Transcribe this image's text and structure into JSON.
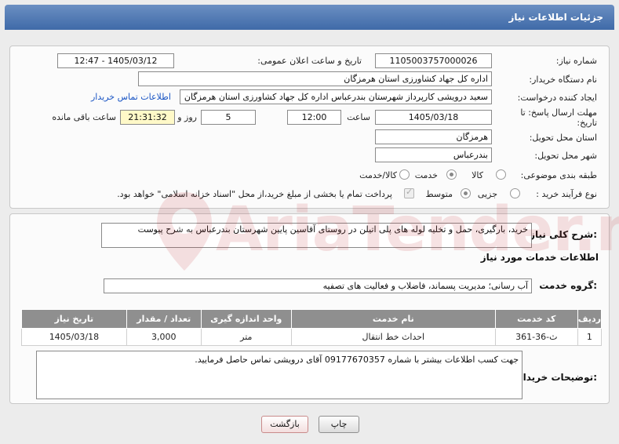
{
  "header": {
    "title": "جزئیات اطلاعات نیاز"
  },
  "form": {
    "need_number_label": "شماره نیاز:",
    "need_number": "1105003757000026",
    "announce_label": "تاریخ و ساعت اعلان عمومی:",
    "announce_value": "1405/03/12 - 12:47",
    "buyer_org_label": "نام دستگاه خریدار:",
    "buyer_org": "اداره کل جهاد کشاورزی استان هرمزگان",
    "creator_label": "ایجاد کننده درخواست:",
    "creator": "سعید درویشی کارپرداز شهرستان بندرعباس اداره کل جهاد کشاورزی استان هرمزگان",
    "contact_link": "اطلاعات تماس خریدار",
    "deadline_label": "مهلت ارسال پاسخ: تا تاریخ:",
    "deadline_date": "1405/03/18",
    "hour_label": "ساعت",
    "deadline_time": "12:00",
    "days_value": "5",
    "days_label": "روز و",
    "remaining_time": "21:31:32",
    "remaining_label": "ساعت باقی مانده",
    "province_label": "استان محل تحویل:",
    "province": "هرمزگان",
    "city_label": "شهر محل تحویل:",
    "city": "بندرعباس",
    "category_label": "طبقه بندی موضوعی:",
    "category_options": [
      "کالا",
      "خدمت",
      "کالا/خدمت"
    ],
    "process_label": "نوع فرآیند خرید :",
    "process_options": [
      "جزیی",
      "متوسط"
    ],
    "payment_note": "پرداخت تمام یا بخشی از مبلغ خرید،از محل \"اسناد خزانه اسلامی\" خواهد بود."
  },
  "summary": {
    "label": "شرح کلی نیاز:",
    "text": "خرید، بارگیری، حمل و تخلیه لوله های پلی اتیلن در روستای آقاسین پایین شهرستان بندرعباس به شرح پیوست"
  },
  "services": {
    "section_title": "اطلاعات خدمات مورد نیاز",
    "group_label": "گروه خدمت:",
    "group_value": "آب رسانی؛ مدیریت پسماند، فاضلاب و فعالیت های تصفیه",
    "columns": [
      "ردیف",
      "کد خدمت",
      "نام خدمت",
      "واحد اندازه گیری",
      "تعداد / مقدار",
      "تاریخ نیاز"
    ],
    "rows": [
      [
        "1",
        "ث-36-361",
        "احداث خط انتقال",
        "متر",
        "3,000",
        "1405/03/18"
      ]
    ]
  },
  "notes": {
    "label": "توضیحات خریدار:",
    "text": "جهت کسب اطلاعات بیشتر با شماره 09177670357 آقای درویشی تماس حاصل فرمایید."
  },
  "buttons": {
    "print": "چاپ",
    "back": "بازگشت"
  },
  "watermark": {
    "text": "AriaTender.net"
  }
}
